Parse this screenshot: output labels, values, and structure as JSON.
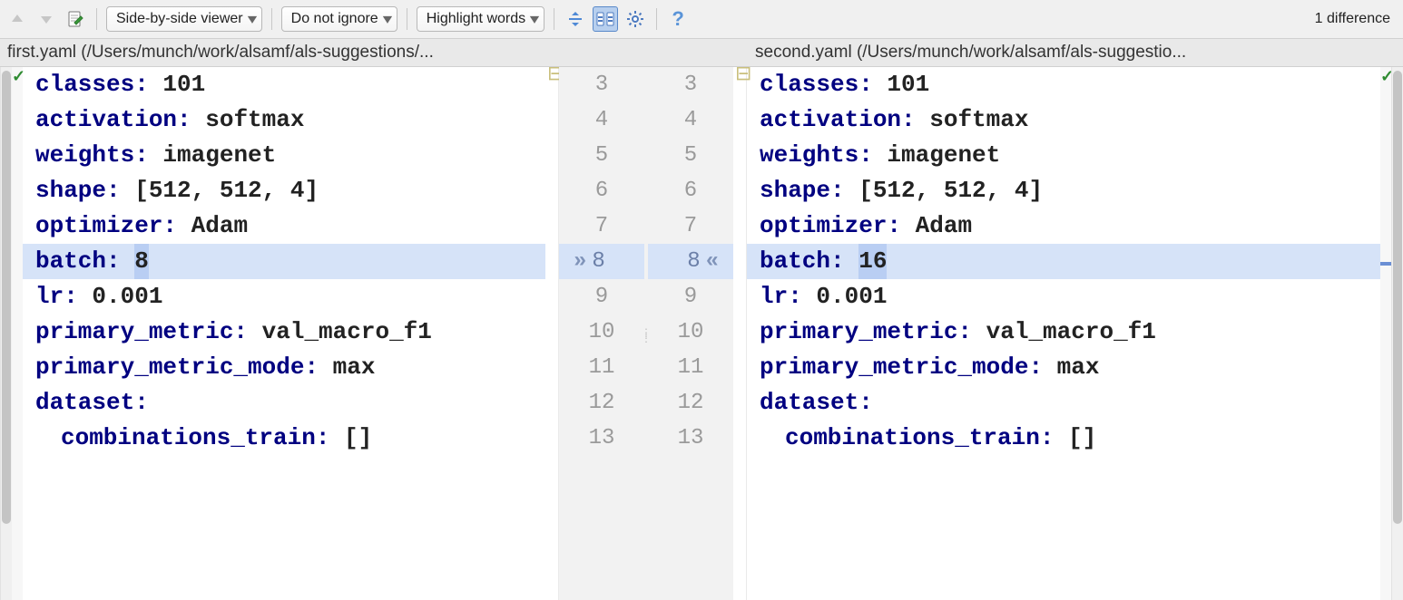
{
  "toolbar": {
    "viewer_mode": "Side-by-side viewer",
    "ignore_mode": "Do not ignore",
    "highlight_mode": "Highlight words"
  },
  "status": "1 difference",
  "files": {
    "left": "first.yaml (/Users/munch/work/alsamf/als-suggestions/...",
    "right": "second.yaml (/Users/munch/work/alsamf/als-suggestio..."
  },
  "line_numbers": {
    "left": [
      "3",
      "4",
      "5",
      "6",
      "7",
      "8",
      "9",
      "10",
      "11",
      "12",
      "13"
    ],
    "right": [
      "3",
      "4",
      "5",
      "6",
      "7",
      "8",
      "9",
      "10",
      "11",
      "12",
      "13"
    ]
  },
  "diff_index": 5,
  "left_lines": [
    {
      "key": "classes:",
      "val": " 101"
    },
    {
      "key": "activation:",
      "val": " softmax"
    },
    {
      "key": "weights:",
      "val": " imagenet"
    },
    {
      "key": "shape:",
      "val": " [512, 512, 4]"
    },
    {
      "key": "optimizer:",
      "val": " Adam"
    },
    {
      "key": "batch:",
      "val": " ",
      "hlval": "8",
      "diff": true
    },
    {
      "key": "lr:",
      "val": " 0.001"
    },
    {
      "key": "primary_metric:",
      "val": " val_macro_f1"
    },
    {
      "key": "primary_metric_mode:",
      "val": " max"
    },
    {
      "key": "dataset:",
      "val": ""
    },
    {
      "key": "combinations_train:",
      "val": " []",
      "indent": true
    }
  ],
  "right_lines": [
    {
      "key": "classes:",
      "val": " 101"
    },
    {
      "key": "activation:",
      "val": " softmax"
    },
    {
      "key": "weights:",
      "val": " imagenet"
    },
    {
      "key": "shape:",
      "val": " [512, 512, 4]"
    },
    {
      "key": "optimizer:",
      "val": " Adam"
    },
    {
      "key": "batch:",
      "val": " ",
      "hlval": "16",
      "diff": true
    },
    {
      "key": "lr:",
      "val": " 0.001"
    },
    {
      "key": "primary_metric:",
      "val": " val_macro_f1"
    },
    {
      "key": "primary_metric_mode:",
      "val": " max"
    },
    {
      "key": "dataset:",
      "val": ""
    },
    {
      "key": "combinations_train:",
      "val": " []",
      "indent": true
    }
  ],
  "icons": {
    "prev": "prev-diff-icon",
    "next": "next-diff-icon",
    "edit": "edit-icon",
    "collapse": "collapse-icon",
    "sync": "sync-scroll-icon",
    "gear": "settings-icon",
    "help": "help-icon"
  }
}
